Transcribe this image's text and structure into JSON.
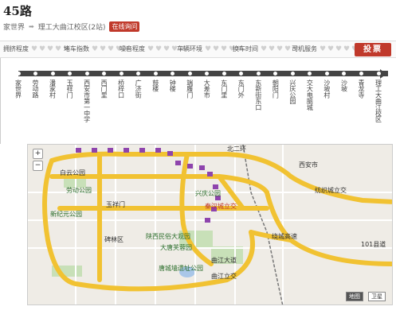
{
  "route": {
    "title": "45路",
    "from": "家世界",
    "to": "理工大曲江校区(2站)",
    "badge": "在线询问"
  },
  "ratings": [
    {
      "label": "拥挤程度"
    },
    {
      "label": "堵车指数"
    },
    {
      "label": "噪音程度"
    },
    {
      "label": "车辆环境"
    },
    {
      "label": "换车时间"
    },
    {
      "label": "司机服务"
    }
  ],
  "heart_glyph": "♥",
  "vote_label": "投票",
  "stops": [
    "家世界",
    "劳动路",
    "潘家村",
    "玉祥门",
    "西安市第一中学",
    "西门里",
    "桥梓口",
    "广济街",
    "鼓楼",
    "钟楼",
    "端履门",
    "大差市",
    "东门里",
    "东门外",
    "东新街东口",
    "朝阳门",
    "兴庆公园",
    "交大电脑城",
    "沙坡村",
    "沙坡",
    "青龙寺",
    "理工大曲江校区"
  ],
  "map": {
    "zoom_in": "+",
    "zoom_out": "−",
    "labels": [
      {
        "text": "白云公园",
        "cls": ""
      },
      {
        "text": "劳动公园",
        "cls": "green"
      },
      {
        "text": "新纪元公园",
        "cls": "green"
      },
      {
        "text": "玉祥门",
        "cls": ""
      },
      {
        "text": "碑林区",
        "cls": ""
      },
      {
        "text": "陕西民俗大观园",
        "cls": "green"
      },
      {
        "text": "大唐芙蓉园",
        "cls": "green"
      },
      {
        "text": "曲江立交",
        "cls": ""
      },
      {
        "text": "兴庆公园",
        "cls": "green"
      },
      {
        "text": "秦汉城立交",
        "cls": "orange"
      },
      {
        "text": "唐城墙遗址公园",
        "cls": "green"
      },
      {
        "text": "西安市",
        "cls": ""
      },
      {
        "text": "纺织城立交",
        "cls": ""
      },
      {
        "text": "曲江大道",
        "cls": ""
      },
      {
        "text": "101县道",
        "cls": ""
      },
      {
        "text": "绕城高速",
        "cls": ""
      },
      {
        "text": "北二环",
        "cls": ""
      }
    ],
    "map_types": [
      "地图",
      "卫星"
    ],
    "colors": {
      "road_major": "#f1c232",
      "road_minor": "#ffffff",
      "bus_marker": "#8e44ad",
      "water": "#a9c7e8"
    }
  }
}
